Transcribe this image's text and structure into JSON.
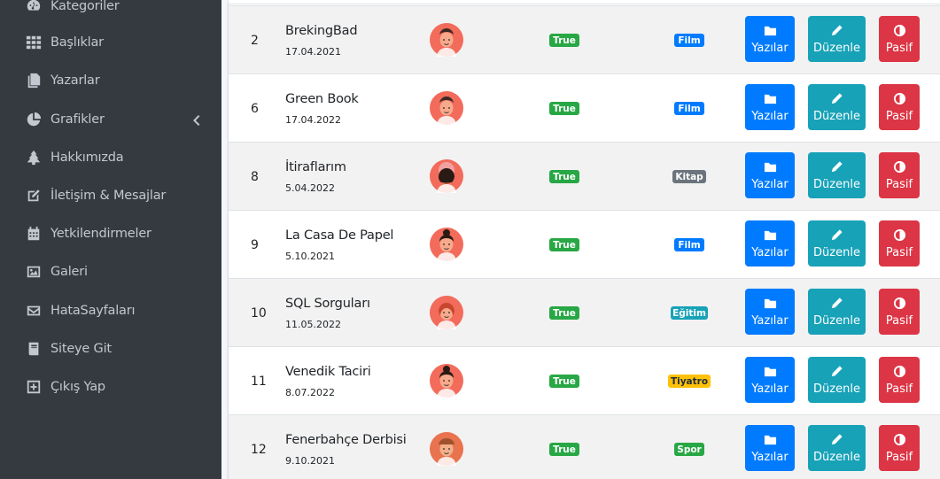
{
  "sidebar": {
    "items": [
      {
        "label": "Kategoriler",
        "icon": "tachometer-icon"
      },
      {
        "label": "Başlıklar",
        "icon": "grid-icon"
      },
      {
        "label": "Yazarlar",
        "icon": "copy-icon"
      },
      {
        "label": "Grafikler",
        "icon": "pie-chart-icon",
        "has_chevron": true
      },
      {
        "label": "Hakkımızda",
        "icon": "tree-icon"
      },
      {
        "label": "İletişim & Mesajlar",
        "icon": "edit-icon"
      },
      {
        "label": "Yetkilendirmeler",
        "icon": "calendar-icon"
      },
      {
        "label": "Galeri",
        "icon": "image-icon"
      },
      {
        "label": "HataSayfaları",
        "icon": "envelope-icon"
      },
      {
        "label": "Siteye Git",
        "icon": "book-icon"
      },
      {
        "label": "Çıkış Yap",
        "icon": "plus-square-icon"
      }
    ]
  },
  "table": {
    "rows": [
      {
        "id": "2",
        "title": "BrekingBad",
        "date": "17.04.2021",
        "status": "True",
        "category": "Film",
        "category_color": "#007bff",
        "avatar": "man-face"
      },
      {
        "id": "6",
        "title": "Green Book",
        "date": "17.04.2022",
        "status": "True",
        "category": "Film",
        "category_color": "#007bff",
        "avatar": "man-face"
      },
      {
        "id": "8",
        "title": "İtiraflarım",
        "date": "5.04.2022",
        "status": "True",
        "category": "Kitap",
        "category_color": "#6c757d",
        "avatar": "woman-curly-face"
      },
      {
        "id": "9",
        "title": "La Casa De Papel",
        "date": "5.10.2021",
        "status": "True",
        "category": "Film",
        "category_color": "#007bff",
        "avatar": "woman-bun-face"
      },
      {
        "id": "10",
        "title": "SQL Sorguları",
        "date": "11.05.2022",
        "status": "True",
        "category": "Eğitim",
        "category_color": "#17a2b8",
        "avatar": "woman-red-face"
      },
      {
        "id": "11",
        "title": "Venedik Taciri",
        "date": "8.07.2022",
        "status": "True",
        "category": "Tiyatro",
        "category_color": "#ffc107",
        "avatar": "woman-bun-face"
      },
      {
        "id": "12",
        "title": "Fenerbahçe Derbisi",
        "date": "9.10.2021",
        "status": "True",
        "category": "Spor",
        "category_color": "#28a745",
        "avatar": "man-hat-face"
      }
    ]
  },
  "buttons": {
    "yazilar": "Yazılar",
    "duzenle": "Düzenle",
    "pasif": "Pasif"
  },
  "colors": {
    "sidebar_bg": "#343a40",
    "primary": "#007bff",
    "info": "#17a2b8",
    "danger": "#dc3545",
    "success": "#28a745"
  }
}
